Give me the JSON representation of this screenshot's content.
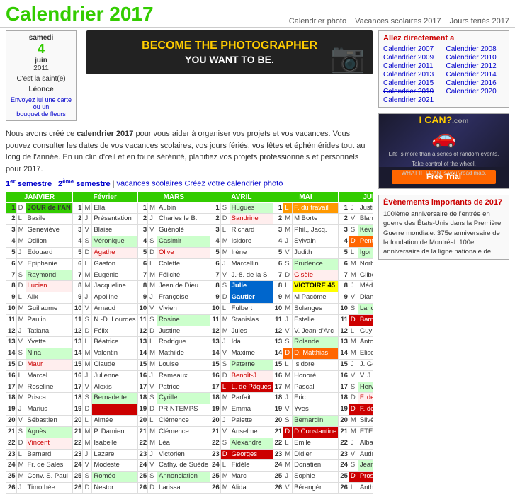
{
  "header": {
    "title": "Calendrier 2017",
    "nav_links": [
      "Calendrier photo",
      "Vacances scolaires 2017",
      "Jours fériés 2017"
    ]
  },
  "saint_box": {
    "day": "samedi",
    "date": "4",
    "month": "juin",
    "year": "2011",
    "name": "C'est la saint(e)",
    "saint_name": "Léonce",
    "card_text": "Envoyez lui une",
    "card_link": "carte",
    "or_text": "ou un",
    "bouquet_link": "bouquet de fleurs"
  },
  "banner": {
    "line1": "BECOME THE PHOTOGRAPHER",
    "line2": "YOU WANT TO BE."
  },
  "intro": {
    "text1": "Nous avons créé ce ",
    "bold": "calendrier 2017",
    "text2": " pour vous aider à organiser vos projets et vos vacances. Vous pouvez consulter les dates de vos vacances scolaires, vos jours fériés, vos fêtes et éphémérides tout au long de l'année. En un clin d'œil et en toute sérénité, planifiez vos projets professionnels et personnels pour 2017."
  },
  "semester_nav": {
    "label1": "1",
    "sup1": "er",
    "text1": " semestre | ",
    "label2": "2",
    "sup2": "ème",
    "text2": " semestre | vacances scolaires Créez votre calendrier photo"
  },
  "months": {
    "janvier": "JANVIER",
    "fevrier": "Février",
    "mars": "MARS",
    "avril": "AVRIL",
    "mai": "MAI",
    "juin": "JUIN"
  },
  "sidebar": {
    "title": "Allez directement a",
    "links": [
      "Calendrier 2007",
      "Calendrier 2008",
      "Calendrier 2009",
      "Calendrier 2010",
      "Calendrier 2011",
      "Calendrier 2012",
      "Calendrier 2013",
      "Calendrier 2014",
      "Calendrier 2015",
      "Calendrier 2016",
      "Calendrier 2019",
      "Calendrier 2020",
      "Calendrier 2021",
      ""
    ]
  },
  "ad": {
    "title": "WHAT IF I CAN?",
    "subtitle": ".com",
    "body1": "Life is more than a series of random events.",
    "body2": "Take control of the wheel.",
    "body3": "WHAT IF I CAN is your road map.",
    "cta": "Free Trial"
  },
  "events": {
    "title": "Évènements importants de 2017",
    "text": "100ième anniversaire de l'entrée en guerre des États-Unis dans la Première Guerre mondiale. 375e anniversaire de la fondation de Montréal. 100e anniversaire de la ligne nationale de..."
  }
}
